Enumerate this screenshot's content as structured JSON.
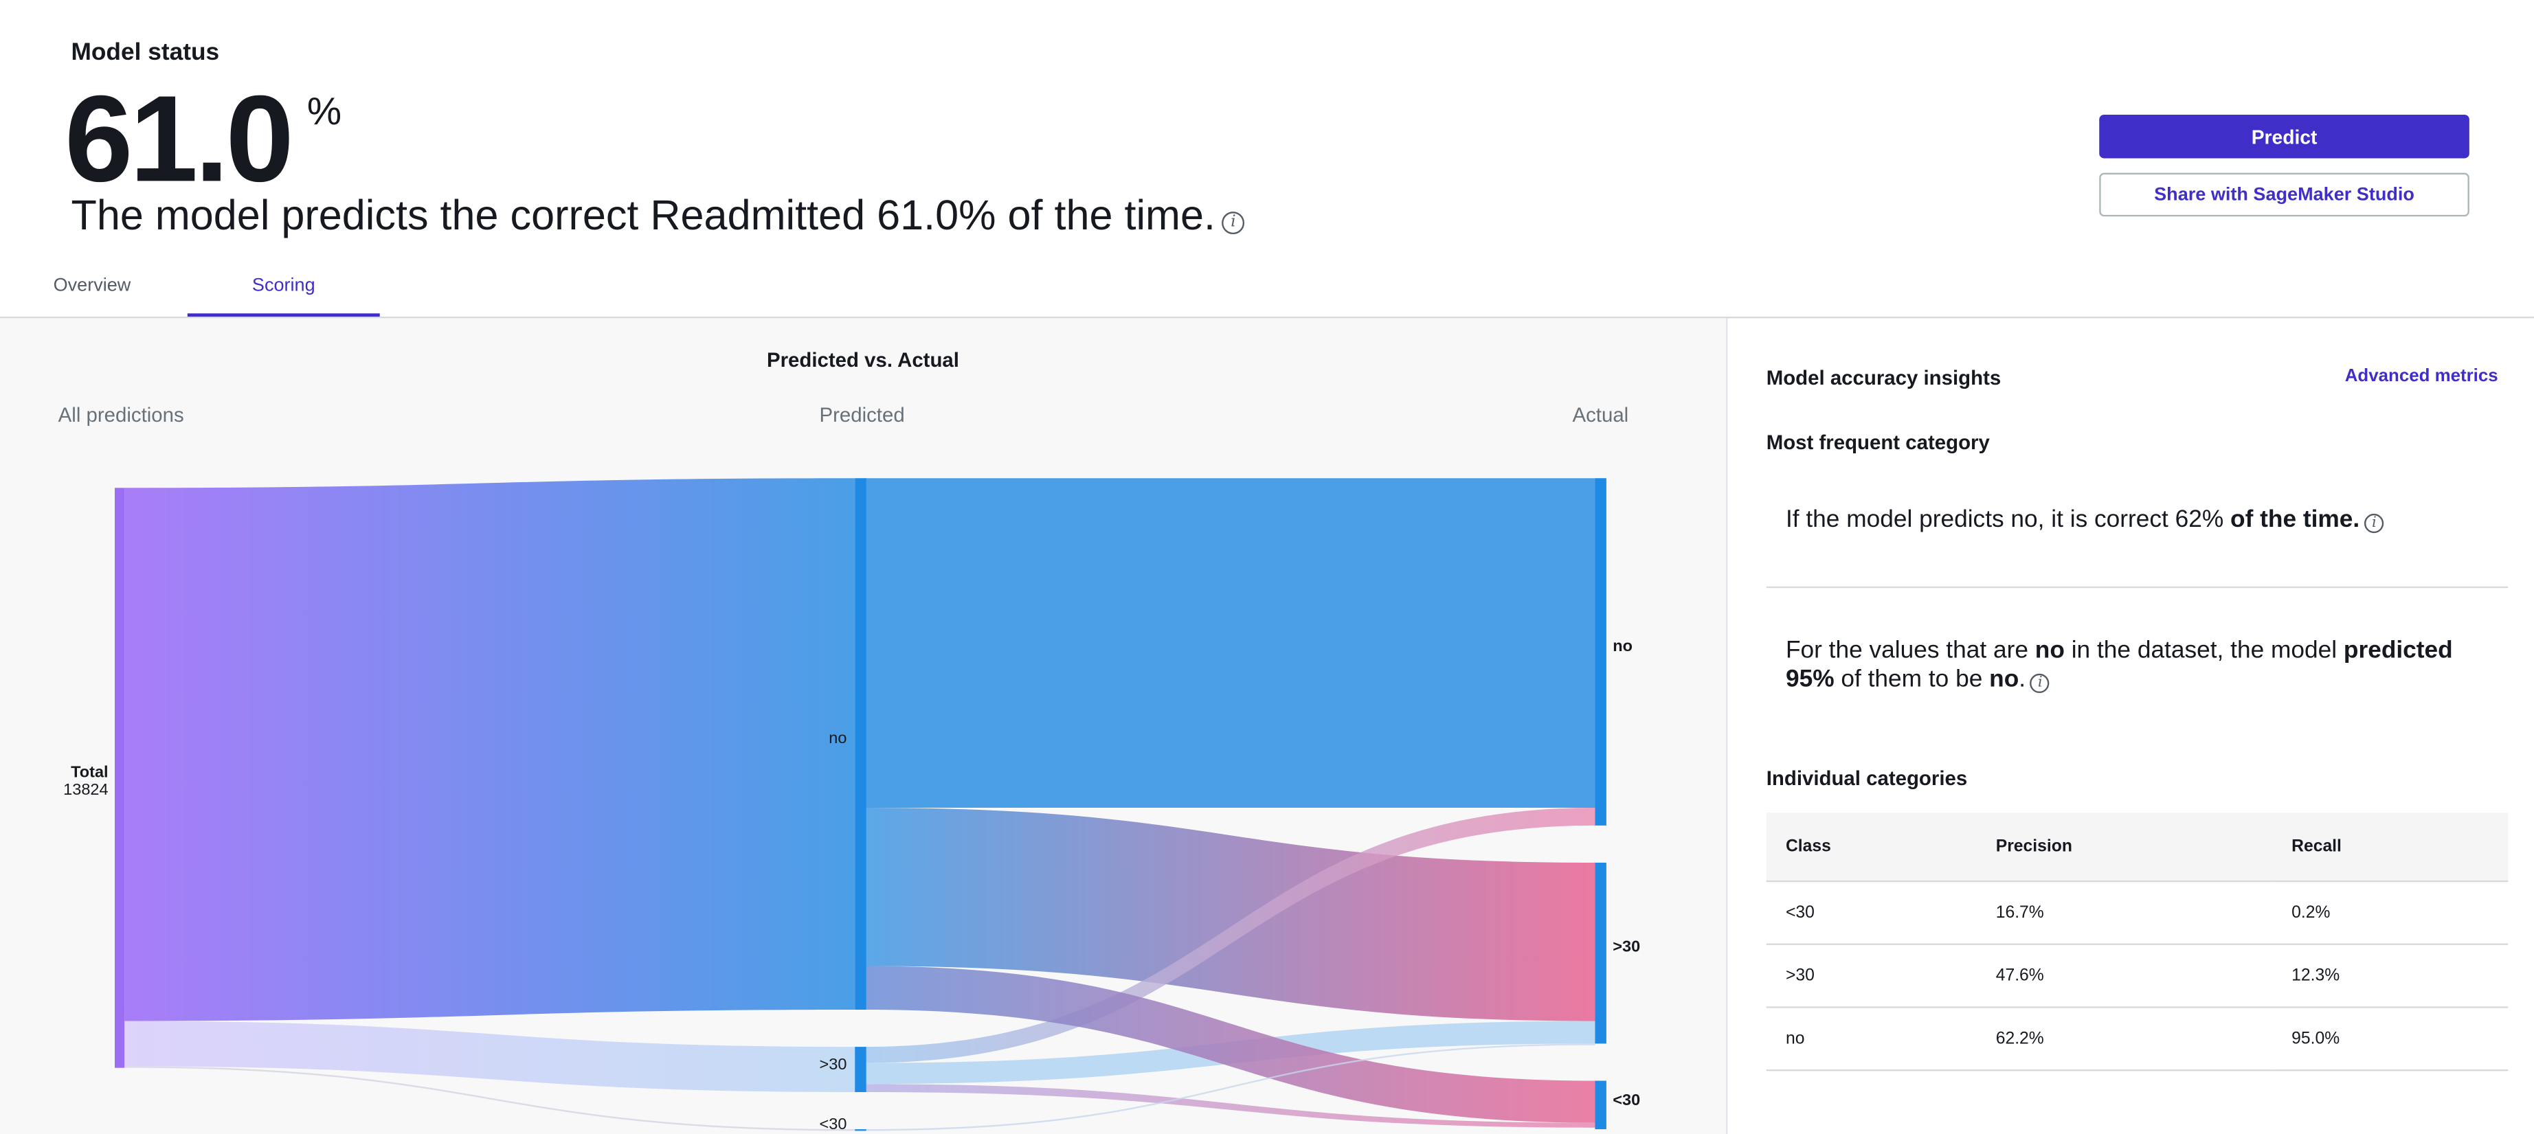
{
  "header": {
    "status_label": "Model status",
    "big_number": "61.0",
    "percent_sign": "%",
    "headline": "The model predicts the correct Readmitted 61.0% of the time.",
    "predict_button": "Predict",
    "share_button": "Share with SageMaker Studio"
  },
  "tabs": [
    {
      "label": "Overview",
      "active": false
    },
    {
      "label": "Scoring",
      "active": true
    }
  ],
  "colors": {
    "accent": "#3f2fc8",
    "flow_blue": "#4a9fe6",
    "flow_purple": "#a97df8",
    "flow_pink": "#e96b97"
  },
  "chart_data": {
    "type": "sankey",
    "title": "Predicted vs. Actual",
    "column_labels": [
      "All predictions",
      "Predicted",
      "Actual"
    ],
    "nodes": {
      "total": {
        "label": "Total",
        "value": "13824"
      },
      "predicted": [
        "no",
        ">30",
        "<30"
      ],
      "actual": [
        "no",
        ">30",
        "<30"
      ]
    }
  },
  "insights": {
    "title": "Model accuracy insights",
    "advanced_link": "Advanced metrics",
    "most_frequent": "Most frequent category",
    "insight1_text": "If the model predicts no, it is correct 62%",
    "insight1_bold": "of the time.",
    "insight2": {
      "t1": "For the values that are",
      "b1": "no",
      "t2": "in the dataset, the model",
      "b2": "predicted 95%",
      "t3": "of them to be",
      "b3": "no",
      "t4": "."
    },
    "individual_title": "Individual categories"
  },
  "table": {
    "headers": [
      "Class",
      "Precision",
      "Recall"
    ],
    "rows": [
      [
        "<30",
        "16.7%",
        "0.2%"
      ],
      [
        ">30",
        "47.6%",
        "12.3%"
      ],
      [
        "no",
        "62.2%",
        "95.0%"
      ]
    ]
  }
}
